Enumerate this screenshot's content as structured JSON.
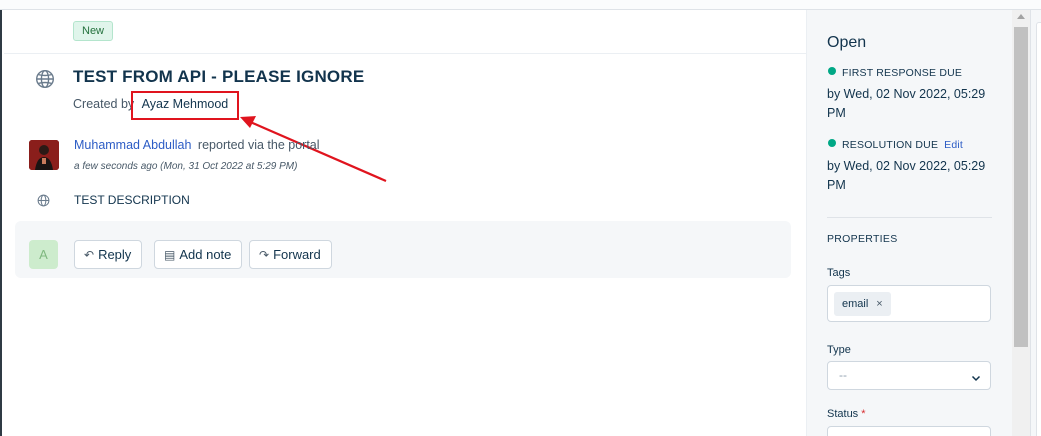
{
  "ticket": {
    "badge": "New",
    "title": "TEST FROM API - PLEASE IGNORE",
    "created_by_label": "Created by",
    "created_by_name": "Ayaz Mehmood"
  },
  "conversation": {
    "reporter_name": "Muhammad Abdullah",
    "reporter_action": "reported via the portal",
    "timestamp": "a few seconds ago (Mon, 31 Oct 2022 at 5:29 PM)",
    "description": "TEST DESCRIPTION"
  },
  "reply_bar": {
    "agent_initial": "A",
    "reply_label": "Reply",
    "add_note_label": "Add note",
    "forward_label": "Forward"
  },
  "sidebar": {
    "status": "Open",
    "first_response_label": "FIRST RESPONSE DUE",
    "first_response_value": "by Wed, 02 Nov 2022, 05:29 PM",
    "resolution_label": "RESOLUTION DUE",
    "resolution_edit": "Edit",
    "resolution_value": "by Wed, 02 Nov 2022, 05:29 PM",
    "properties_heading": "PROPERTIES",
    "tags_label": "Tags",
    "tags": [
      "email"
    ],
    "tag_remove": "×",
    "type_label": "Type",
    "type_value": "--",
    "status_label": "Status",
    "status_required": "*"
  },
  "colors": {
    "sla_dot": "#00a886",
    "annotation": "#e0141e",
    "link": "#2c5cc5"
  }
}
